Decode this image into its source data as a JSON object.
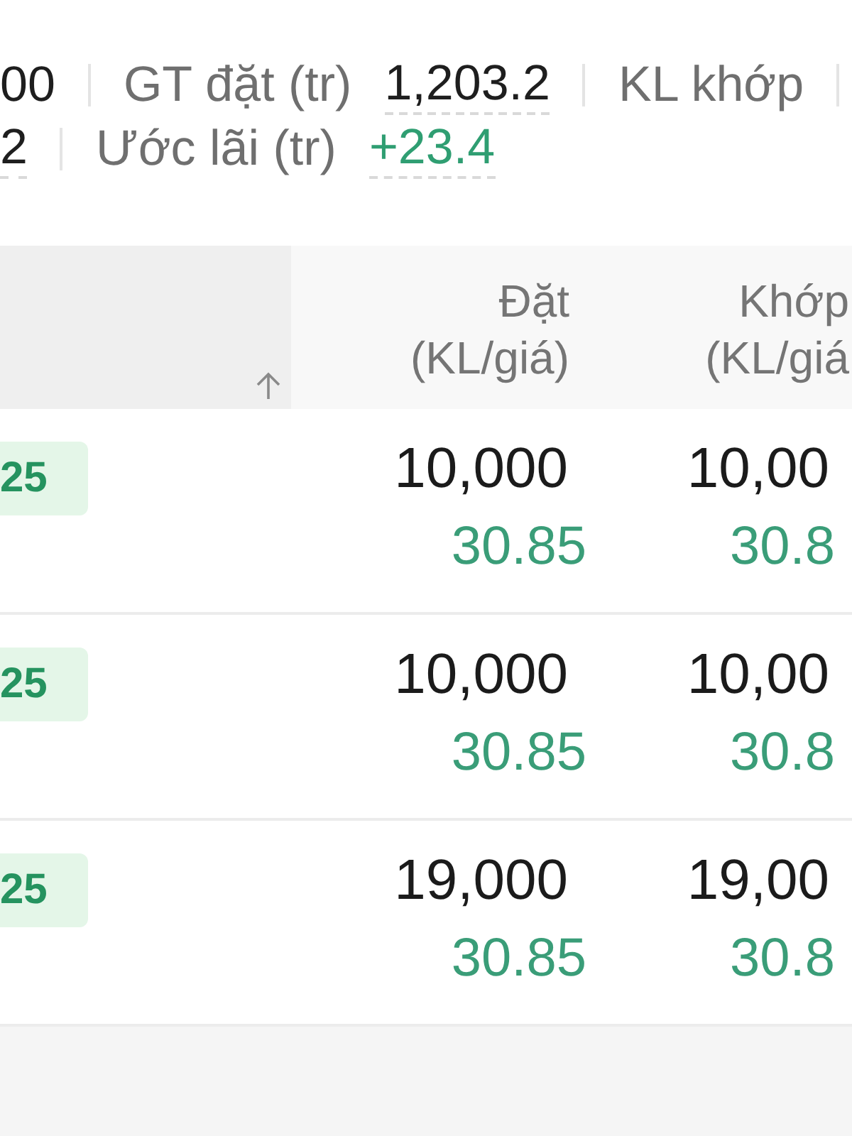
{
  "summary": [
    [
      {
        "kind": "value",
        "text": "00",
        "gain": false,
        "dashed": false
      },
      {
        "kind": "divider"
      },
      {
        "kind": "label",
        "text": "GT đặt (tr)"
      },
      {
        "kind": "value",
        "text": "1,203.2",
        "gain": false,
        "dashed": true
      },
      {
        "kind": "divider"
      },
      {
        "kind": "label",
        "text": "KL khớp"
      },
      {
        "kind": "divider"
      }
    ],
    [
      {
        "kind": "value",
        "text": "2",
        "gain": false,
        "dashed": true
      },
      {
        "kind": "divider"
      },
      {
        "kind": "label",
        "text": "Ước lãi (tr)"
      },
      {
        "kind": "value",
        "text": "+23.4",
        "gain": true,
        "dashed": true
      }
    ]
  ],
  "table": {
    "columns": [
      {
        "sorted": true,
        "ascending": true
      },
      {
        "title": "Đặt",
        "unit": "(KL/giá)"
      },
      {
        "title": "Khớp",
        "unit": "(KL/giá"
      }
    ],
    "rows": [
      {
        "tag": "25",
        "order_qty": "10,000",
        "order_price": "30.85",
        "match_qty": "10,00",
        "match_price": "30.8"
      },
      {
        "tag": "25",
        "order_qty": "10,000",
        "order_price": "30.85",
        "match_qty": "10,00",
        "match_price": "30.8"
      },
      {
        "tag": "25",
        "order_qty": "19,000",
        "order_price": "30.85",
        "match_qty": "19,00",
        "match_price": "30.8"
      }
    ]
  }
}
